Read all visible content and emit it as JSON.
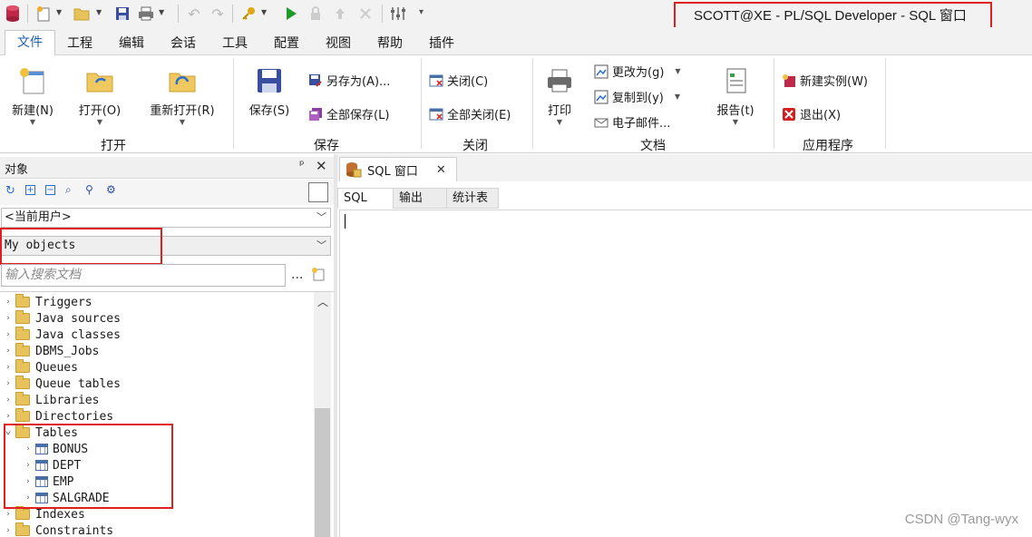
{
  "window": {
    "title": "SCOTT@XE - PL/SQL Developer - SQL 窗口"
  },
  "menu": {
    "tabs": [
      "文件",
      "工程",
      "编辑",
      "会话",
      "工具",
      "配置",
      "视图",
      "帮助",
      "插件"
    ]
  },
  "ribbon": {
    "open_group": {
      "new": "新建(N)",
      "open": "打开(O)",
      "reopen": "重新打开(R)",
      "label": "打开"
    },
    "save_group": {
      "save": "保存(S)",
      "save_as": "另存为(A)...",
      "save_all": "全部保存(L)",
      "label": "保存"
    },
    "close_group": {
      "close": "关闭(C)",
      "close_all": "全部关闭(E)",
      "label": "关闭"
    },
    "doc_group": {
      "print": "打印",
      "change_to": "更改为(g)",
      "copy_to": "复制到(y)",
      "email": "电子邮件...",
      "report": "报告(t)",
      "label": "文档"
    },
    "app_group": {
      "new_instance": "新建实例(W)",
      "exit": "退出(X)",
      "label": "应用程序"
    }
  },
  "objects_panel": {
    "title": "对象",
    "user_combo": "<当前用户>",
    "filter_combo": "My objects",
    "search_placeholder": "输入搜索文档",
    "tree": [
      {
        "label": "Triggers",
        "type": "folder"
      },
      {
        "label": "Java sources",
        "type": "folder"
      },
      {
        "label": "Java classes",
        "type": "folder"
      },
      {
        "label": "DBMS_Jobs",
        "type": "folder"
      },
      {
        "label": "Queues",
        "type": "folder"
      },
      {
        "label": "Queue tables",
        "type": "folder"
      },
      {
        "label": "Libraries",
        "type": "folder"
      },
      {
        "label": "Directories",
        "type": "folder"
      },
      {
        "label": "Tables",
        "type": "folder",
        "expanded": true
      },
      {
        "label": "BONUS",
        "type": "table"
      },
      {
        "label": "DEPT",
        "type": "table"
      },
      {
        "label": "EMP",
        "type": "table"
      },
      {
        "label": "SALGRADE",
        "type": "table"
      },
      {
        "label": "Indexes",
        "type": "folder"
      },
      {
        "label": "Constraints",
        "type": "folder"
      }
    ]
  },
  "document": {
    "tab_label": "SQL 窗口",
    "subtabs": [
      "SQL",
      "输出",
      "统计表"
    ],
    "watermark": "CSDN @Tang-wyx"
  },
  "colors": {
    "accent": "#1f5fb0",
    "highlight_box": "#e02020"
  }
}
